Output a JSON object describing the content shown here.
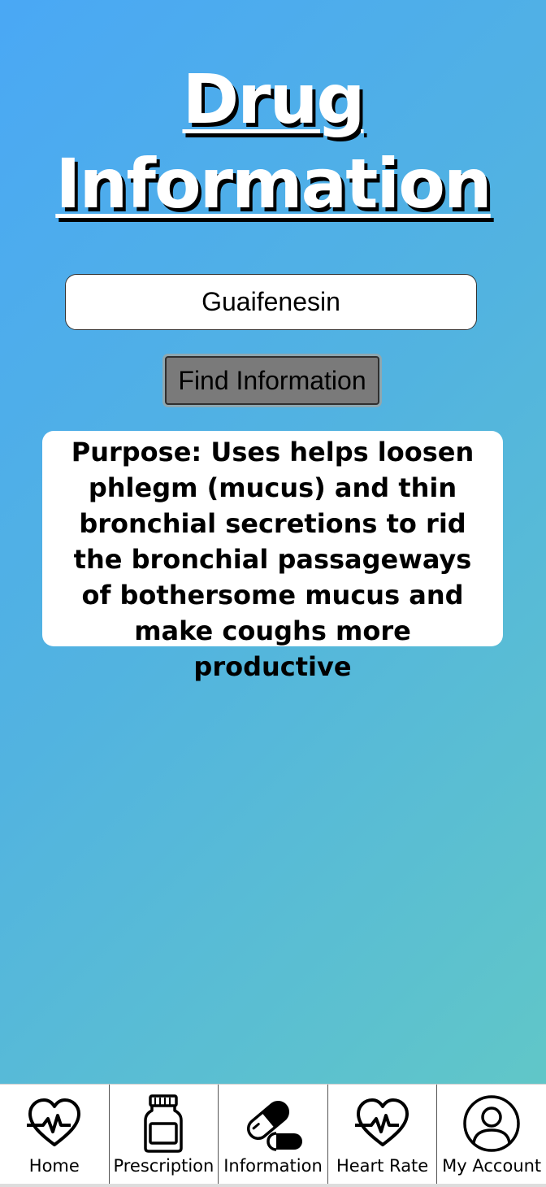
{
  "header": {
    "title_line1": "Drug",
    "title_line2": "Information"
  },
  "search": {
    "value": "Guaifenesin",
    "placeholder": ""
  },
  "find_button": {
    "label": "Find Information"
  },
  "result": {
    "text": "Purpose: Uses helps loosen phlegm (mucus) and thin bronchial secretions to rid the bronchial passageways of bothersome mucus and make coughs more productive"
  },
  "nav": {
    "items": [
      {
        "label": "Home",
        "icon": "heartbeat-icon"
      },
      {
        "label": "Prescription",
        "icon": "pill-bottle-icon"
      },
      {
        "label": "Information",
        "icon": "capsule-icon"
      },
      {
        "label": "Heart Rate",
        "icon": "heartbeat-icon"
      },
      {
        "label": "My Account",
        "icon": "user-icon"
      }
    ]
  },
  "colors": {
    "gradient_start": "#4aa8f5",
    "gradient_end": "#62c9c5",
    "button_bg": "#7a7a7a"
  }
}
